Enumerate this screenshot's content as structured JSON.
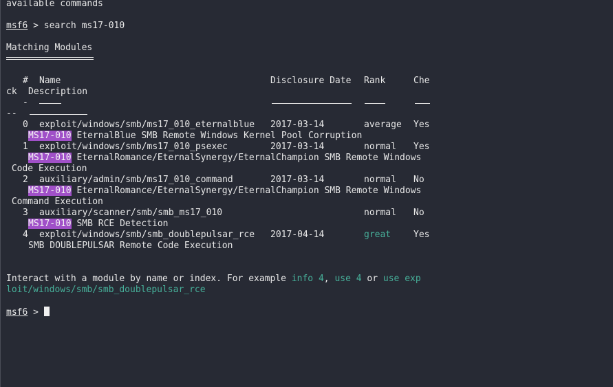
{
  "header_line": "available commands",
  "prompt": {
    "name": "msf6",
    "sep": " > ",
    "command": "search ms17-010"
  },
  "section_title": "Matching Modules",
  "columns": {
    "num": "#",
    "name": "Name",
    "date": "Disclosure Date",
    "rank": "Rank",
    "check_a": "Che",
    "check_b": "ck",
    "desc": "Description",
    "num_ul": "-",
    "check_ul_b": "--"
  },
  "modules": [
    {
      "index": "0",
      "name": "exploit/windows/smb/ms17_010_eternalblue",
      "date": "2017-03-14",
      "rank": "average",
      "check": "Yes",
      "tag": "MS17-010",
      "desc1": " EternalBlue SMB Remote Windows Kernel Pool Corruption",
      "desc2": ""
    },
    {
      "index": "1",
      "name": "exploit/windows/smb/ms17_010_psexec",
      "date": "2017-03-14",
      "rank": "normal",
      "check": "Yes",
      "tag": "MS17-010",
      "desc1": " EternalRomance/EternalSynergy/EternalChampion SMB Remote Windows",
      "desc2": " Code Execution"
    },
    {
      "index": "2",
      "name": "auxiliary/admin/smb/ms17_010_command",
      "date": "2017-03-14",
      "rank": "normal",
      "check": "No",
      "tag": "MS17-010",
      "desc1": " EternalRomance/EternalSynergy/EternalChampion SMB Remote Windows",
      "desc2": " Command Execution"
    },
    {
      "index": "3",
      "name": "auxiliary/scanner/smb/smb_ms17_010",
      "date": "",
      "rank": "normal",
      "check": "No",
      "tag": "MS17-010",
      "desc1": " SMB RCE Detection",
      "desc2": ""
    },
    {
      "index": "4",
      "name": "exploit/windows/smb/smb_doublepulsar_rce",
      "date": "2017-04-14",
      "rank": "great",
      "check": "Yes",
      "tag": "",
      "desc1": "SMB DOUBLEPULSAR Remote Code Execution",
      "desc2": ""
    }
  ],
  "interact": {
    "prefix": "Interact with a module by name or index. For example ",
    "ex1": "info 4",
    "comma": ", ",
    "ex2": "use 4",
    "or": " or ",
    "ex3a": "use exp",
    "ex3b": "loit/windows/smb/smb_doublepulsar_rce"
  },
  "final_prompt": {
    "name": "msf6",
    "sep": " > "
  },
  "colors": {
    "background": "#272a34",
    "text": "#e8e8e8",
    "highlight": "#a050c8",
    "green": "#47b09a"
  }
}
